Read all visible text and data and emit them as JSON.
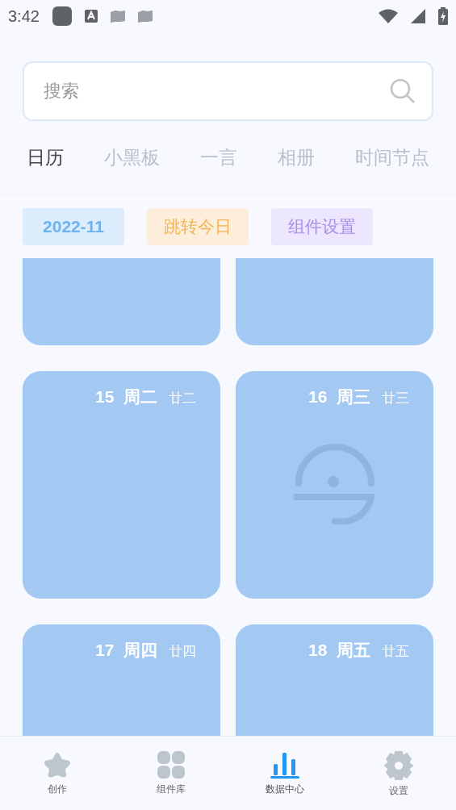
{
  "status_bar": {
    "time": "3:42"
  },
  "search": {
    "placeholder": "搜索"
  },
  "tabs": [
    {
      "label": "日历",
      "selected": true
    },
    {
      "label": "小黑板",
      "selected": false
    },
    {
      "label": "一言",
      "selected": false
    },
    {
      "label": "相册",
      "selected": false
    },
    {
      "label": "时间节点",
      "selected": false
    }
  ],
  "chips": [
    {
      "label": "2022-11",
      "kind": "month"
    },
    {
      "label": "跳转今日",
      "kind": "today"
    },
    {
      "label": "组件设置",
      "kind": "settings"
    }
  ],
  "cards": [
    {
      "kind": "cut"
    },
    {
      "kind": "cut"
    },
    {
      "kind": "day",
      "day": "15",
      "weekday": "周二",
      "lunar": "廿二"
    },
    {
      "kind": "empty",
      "day": "16",
      "weekday": "周三",
      "lunar": "廿三"
    },
    {
      "kind": "day",
      "day": "17",
      "weekday": "周四",
      "lunar": "廿四"
    },
    {
      "kind": "day",
      "day": "18",
      "weekday": "周五",
      "lunar": "廿五"
    }
  ],
  "bottom_nav": [
    {
      "label": "创作",
      "selected": false
    },
    {
      "label": "组件库",
      "selected": false
    },
    {
      "label": "数据中心",
      "selected": true
    },
    {
      "label": "设置",
      "selected": false
    }
  ]
}
